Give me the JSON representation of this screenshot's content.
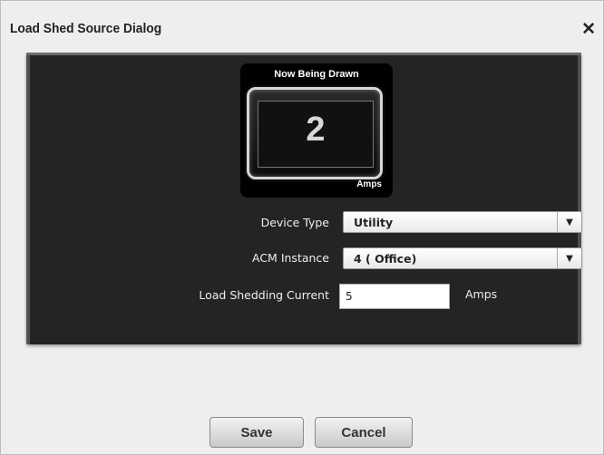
{
  "dialog": {
    "title": "Load Shed Source Dialog",
    "close_glyph": "✕",
    "close_icon": "close-icon"
  },
  "meter": {
    "title": "Now Being Drawn",
    "value": "2",
    "unit": "Amps"
  },
  "form": {
    "device_type": {
      "label": "Device Type",
      "value": "Utility",
      "arrow": "▼"
    },
    "acm_instance": {
      "label": "ACM Instance",
      "value": "4 ( Office)",
      "arrow": "▼"
    },
    "load_shedding_current": {
      "label": "Load Shedding Current",
      "value": "5",
      "unit": "Amps"
    }
  },
  "buttons": {
    "save": "Save",
    "cancel": "Cancel"
  },
  "colors": {
    "panel": "#242424",
    "dialog_bg": "#eeeeee",
    "meter_text": "#d8d8d8"
  }
}
